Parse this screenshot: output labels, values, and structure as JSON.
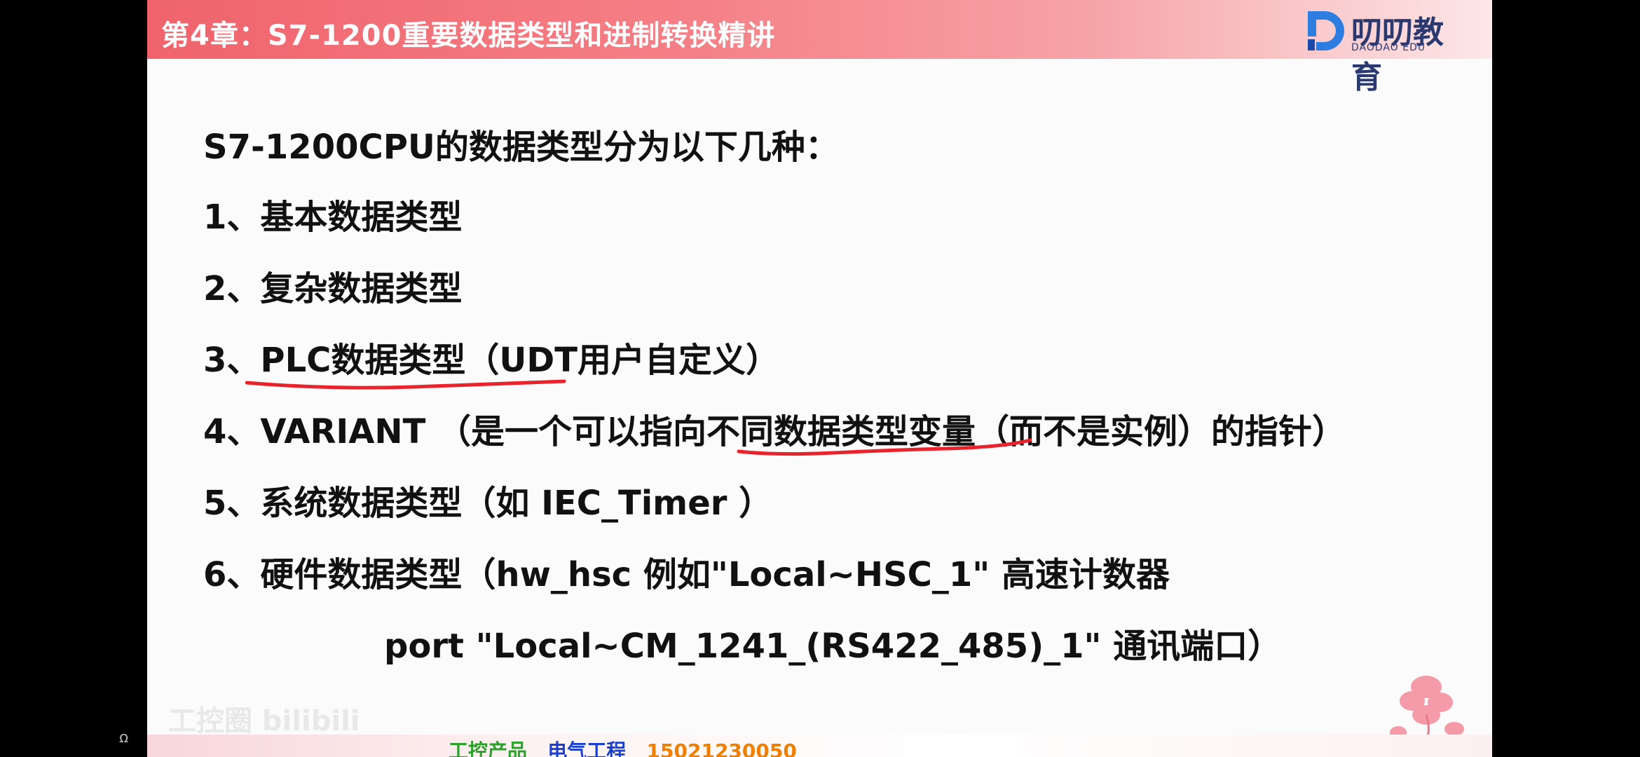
{
  "header": {
    "title": "第4章：S7-1200重要数据类型和进制转换精讲",
    "brand_name": "叨叨教育",
    "brand_sub": "DAODAO EDU"
  },
  "content": {
    "intro": "S7-1200CPU的数据类型分为以下几种：",
    "items": [
      "1、基本数据类型",
      "2、复杂数据类型",
      "3、PLC数据类型（UDT用户自定义）",
      "4、VARIANT （是一个可以指向不同数据类型变量（而不是实例）的指针）",
      "5、系统数据类型（如 IEC_Timer ）",
      "6、硬件数据类型（hw_hsc 例如\"Local~HSC_1\" 高速计数器"
    ],
    "item6_cont": "port     \"Local~CM_1241_(RS422_485)_1\"    通讯端口）"
  },
  "watermark": "工控圈 bilibili",
  "footer": {
    "part1": "工控产品",
    "part2": "电气工程",
    "phone": "15021230050"
  },
  "colors": {
    "header_start": "#f0636c",
    "underline": "#e8232b",
    "footer_green": "#2aa12a",
    "footer_blue": "#1a3fd1",
    "footer_orange": "#f07f00"
  },
  "icons": {
    "corner_left": "people-icon",
    "logo": "daodao-logo-icon",
    "decoration": "flower-decoration-icon"
  }
}
